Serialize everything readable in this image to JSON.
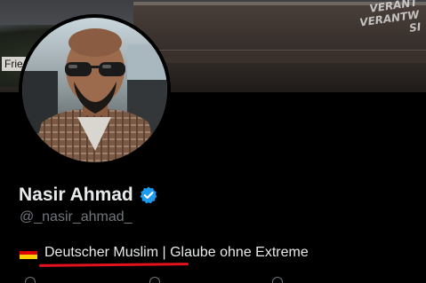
{
  "banner": {
    "sign_text": "Frie",
    "graffiti_text": "VERANT\nVERANTW\nSI"
  },
  "profile": {
    "display_name": "Nasir Ahmad",
    "handle": "@_nasir_ahmad_",
    "bio_flag": "germany-flag-icon",
    "bio_text": "Deutscher Muslim | Glaube ohne Extreme",
    "verified": true
  },
  "colors": {
    "background": "#000000",
    "verified_blue": "#1d9bf0",
    "handle_gray": "#71767b",
    "underline_red": "#e4121c"
  }
}
